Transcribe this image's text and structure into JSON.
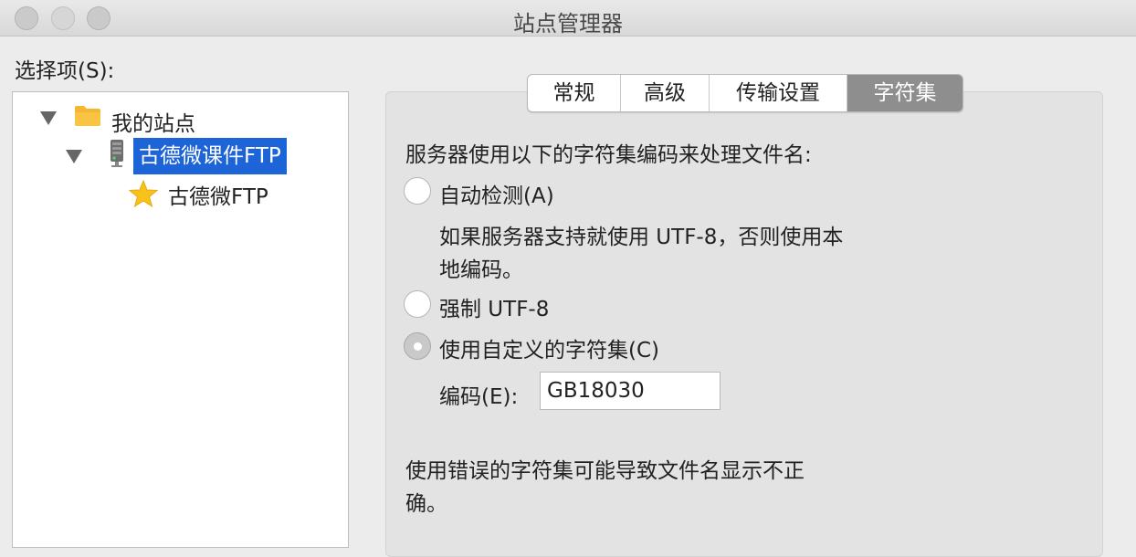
{
  "window": {
    "title": "站点管理器"
  },
  "select_label": "选择项(S):",
  "tree": {
    "items": [
      {
        "label": "我的站点",
        "icon": "folder-icon",
        "expanded": true
      },
      {
        "label": "古德微课件FTP",
        "icon": "server-icon",
        "expanded": true,
        "selected": true
      },
      {
        "label": "古德微FTP",
        "icon": "star-icon"
      }
    ]
  },
  "tabs": [
    {
      "label": "常规"
    },
    {
      "label": "高级"
    },
    {
      "label": "传输设置"
    },
    {
      "label": "字符集",
      "active": true
    }
  ],
  "charset": {
    "intro": "服务器使用以下的字符集编码来处理文件名:",
    "auto_label": "自动检测(A)",
    "auto_desc_line1": "如果服务器支持就使用 UTF-8，否则使用本",
    "auto_desc_line2": "地编码。",
    "force_utf8_label": "强制 UTF-8",
    "custom_label": "使用自定义的字符集(C)",
    "selected_option": "custom",
    "encoding_label": "编码(E):",
    "encoding_value": "GB18030",
    "warning_line1": "使用错误的字符集可能导致文件名显示不正",
    "warning_line2": "确。"
  },
  "colors": {
    "selection": "#1d64d8",
    "active_tab": "#8e8e8e",
    "folder": "#f5b731",
    "star": "#f7c21a"
  }
}
